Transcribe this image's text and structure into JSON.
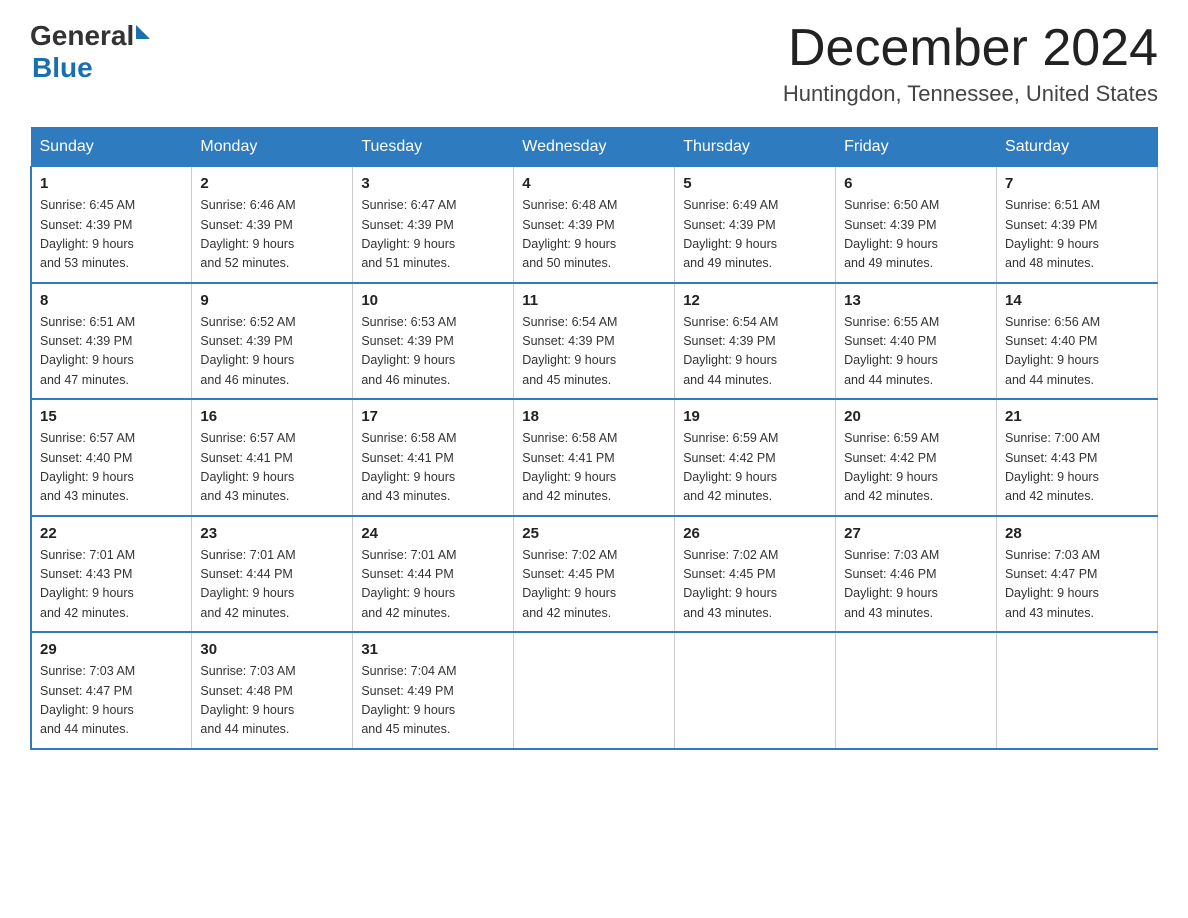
{
  "header": {
    "logo_general": "General",
    "logo_blue": "Blue",
    "month_title": "December 2024",
    "location": "Huntingdon, Tennessee, United States"
  },
  "days_of_week": [
    "Sunday",
    "Monday",
    "Tuesday",
    "Wednesday",
    "Thursday",
    "Friday",
    "Saturday"
  ],
  "weeks": [
    [
      {
        "day": "1",
        "sunrise": "6:45 AM",
        "sunset": "4:39 PM",
        "daylight": "9 hours and 53 minutes."
      },
      {
        "day": "2",
        "sunrise": "6:46 AM",
        "sunset": "4:39 PM",
        "daylight": "9 hours and 52 minutes."
      },
      {
        "day": "3",
        "sunrise": "6:47 AM",
        "sunset": "4:39 PM",
        "daylight": "9 hours and 51 minutes."
      },
      {
        "day": "4",
        "sunrise": "6:48 AM",
        "sunset": "4:39 PM",
        "daylight": "9 hours and 50 minutes."
      },
      {
        "day": "5",
        "sunrise": "6:49 AM",
        "sunset": "4:39 PM",
        "daylight": "9 hours and 49 minutes."
      },
      {
        "day": "6",
        "sunrise": "6:50 AM",
        "sunset": "4:39 PM",
        "daylight": "9 hours and 49 minutes."
      },
      {
        "day": "7",
        "sunrise": "6:51 AM",
        "sunset": "4:39 PM",
        "daylight": "9 hours and 48 minutes."
      }
    ],
    [
      {
        "day": "8",
        "sunrise": "6:51 AM",
        "sunset": "4:39 PM",
        "daylight": "9 hours and 47 minutes."
      },
      {
        "day": "9",
        "sunrise": "6:52 AM",
        "sunset": "4:39 PM",
        "daylight": "9 hours and 46 minutes."
      },
      {
        "day": "10",
        "sunrise": "6:53 AM",
        "sunset": "4:39 PM",
        "daylight": "9 hours and 46 minutes."
      },
      {
        "day": "11",
        "sunrise": "6:54 AM",
        "sunset": "4:39 PM",
        "daylight": "9 hours and 45 minutes."
      },
      {
        "day": "12",
        "sunrise": "6:54 AM",
        "sunset": "4:39 PM",
        "daylight": "9 hours and 44 minutes."
      },
      {
        "day": "13",
        "sunrise": "6:55 AM",
        "sunset": "4:40 PM",
        "daylight": "9 hours and 44 minutes."
      },
      {
        "day": "14",
        "sunrise": "6:56 AM",
        "sunset": "4:40 PM",
        "daylight": "9 hours and 44 minutes."
      }
    ],
    [
      {
        "day": "15",
        "sunrise": "6:57 AM",
        "sunset": "4:40 PM",
        "daylight": "9 hours and 43 minutes."
      },
      {
        "day": "16",
        "sunrise": "6:57 AM",
        "sunset": "4:41 PM",
        "daylight": "9 hours and 43 minutes."
      },
      {
        "day": "17",
        "sunrise": "6:58 AM",
        "sunset": "4:41 PM",
        "daylight": "9 hours and 43 minutes."
      },
      {
        "day": "18",
        "sunrise": "6:58 AM",
        "sunset": "4:41 PM",
        "daylight": "9 hours and 42 minutes."
      },
      {
        "day": "19",
        "sunrise": "6:59 AM",
        "sunset": "4:42 PM",
        "daylight": "9 hours and 42 minutes."
      },
      {
        "day": "20",
        "sunrise": "6:59 AM",
        "sunset": "4:42 PM",
        "daylight": "9 hours and 42 minutes."
      },
      {
        "day": "21",
        "sunrise": "7:00 AM",
        "sunset": "4:43 PM",
        "daylight": "9 hours and 42 minutes."
      }
    ],
    [
      {
        "day": "22",
        "sunrise": "7:01 AM",
        "sunset": "4:43 PM",
        "daylight": "9 hours and 42 minutes."
      },
      {
        "day": "23",
        "sunrise": "7:01 AM",
        "sunset": "4:44 PM",
        "daylight": "9 hours and 42 minutes."
      },
      {
        "day": "24",
        "sunrise": "7:01 AM",
        "sunset": "4:44 PM",
        "daylight": "9 hours and 42 minutes."
      },
      {
        "day": "25",
        "sunrise": "7:02 AM",
        "sunset": "4:45 PM",
        "daylight": "9 hours and 42 minutes."
      },
      {
        "day": "26",
        "sunrise": "7:02 AM",
        "sunset": "4:45 PM",
        "daylight": "9 hours and 43 minutes."
      },
      {
        "day": "27",
        "sunrise": "7:03 AM",
        "sunset": "4:46 PM",
        "daylight": "9 hours and 43 minutes."
      },
      {
        "day": "28",
        "sunrise": "7:03 AM",
        "sunset": "4:47 PM",
        "daylight": "9 hours and 43 minutes."
      }
    ],
    [
      {
        "day": "29",
        "sunrise": "7:03 AM",
        "sunset": "4:47 PM",
        "daylight": "9 hours and 44 minutes."
      },
      {
        "day": "30",
        "sunrise": "7:03 AM",
        "sunset": "4:48 PM",
        "daylight": "9 hours and 44 minutes."
      },
      {
        "day": "31",
        "sunrise": "7:04 AM",
        "sunset": "4:49 PM",
        "daylight": "9 hours and 45 minutes."
      },
      null,
      null,
      null,
      null
    ]
  ],
  "labels": {
    "sunrise": "Sunrise:",
    "sunset": "Sunset:",
    "daylight": "Daylight:"
  }
}
